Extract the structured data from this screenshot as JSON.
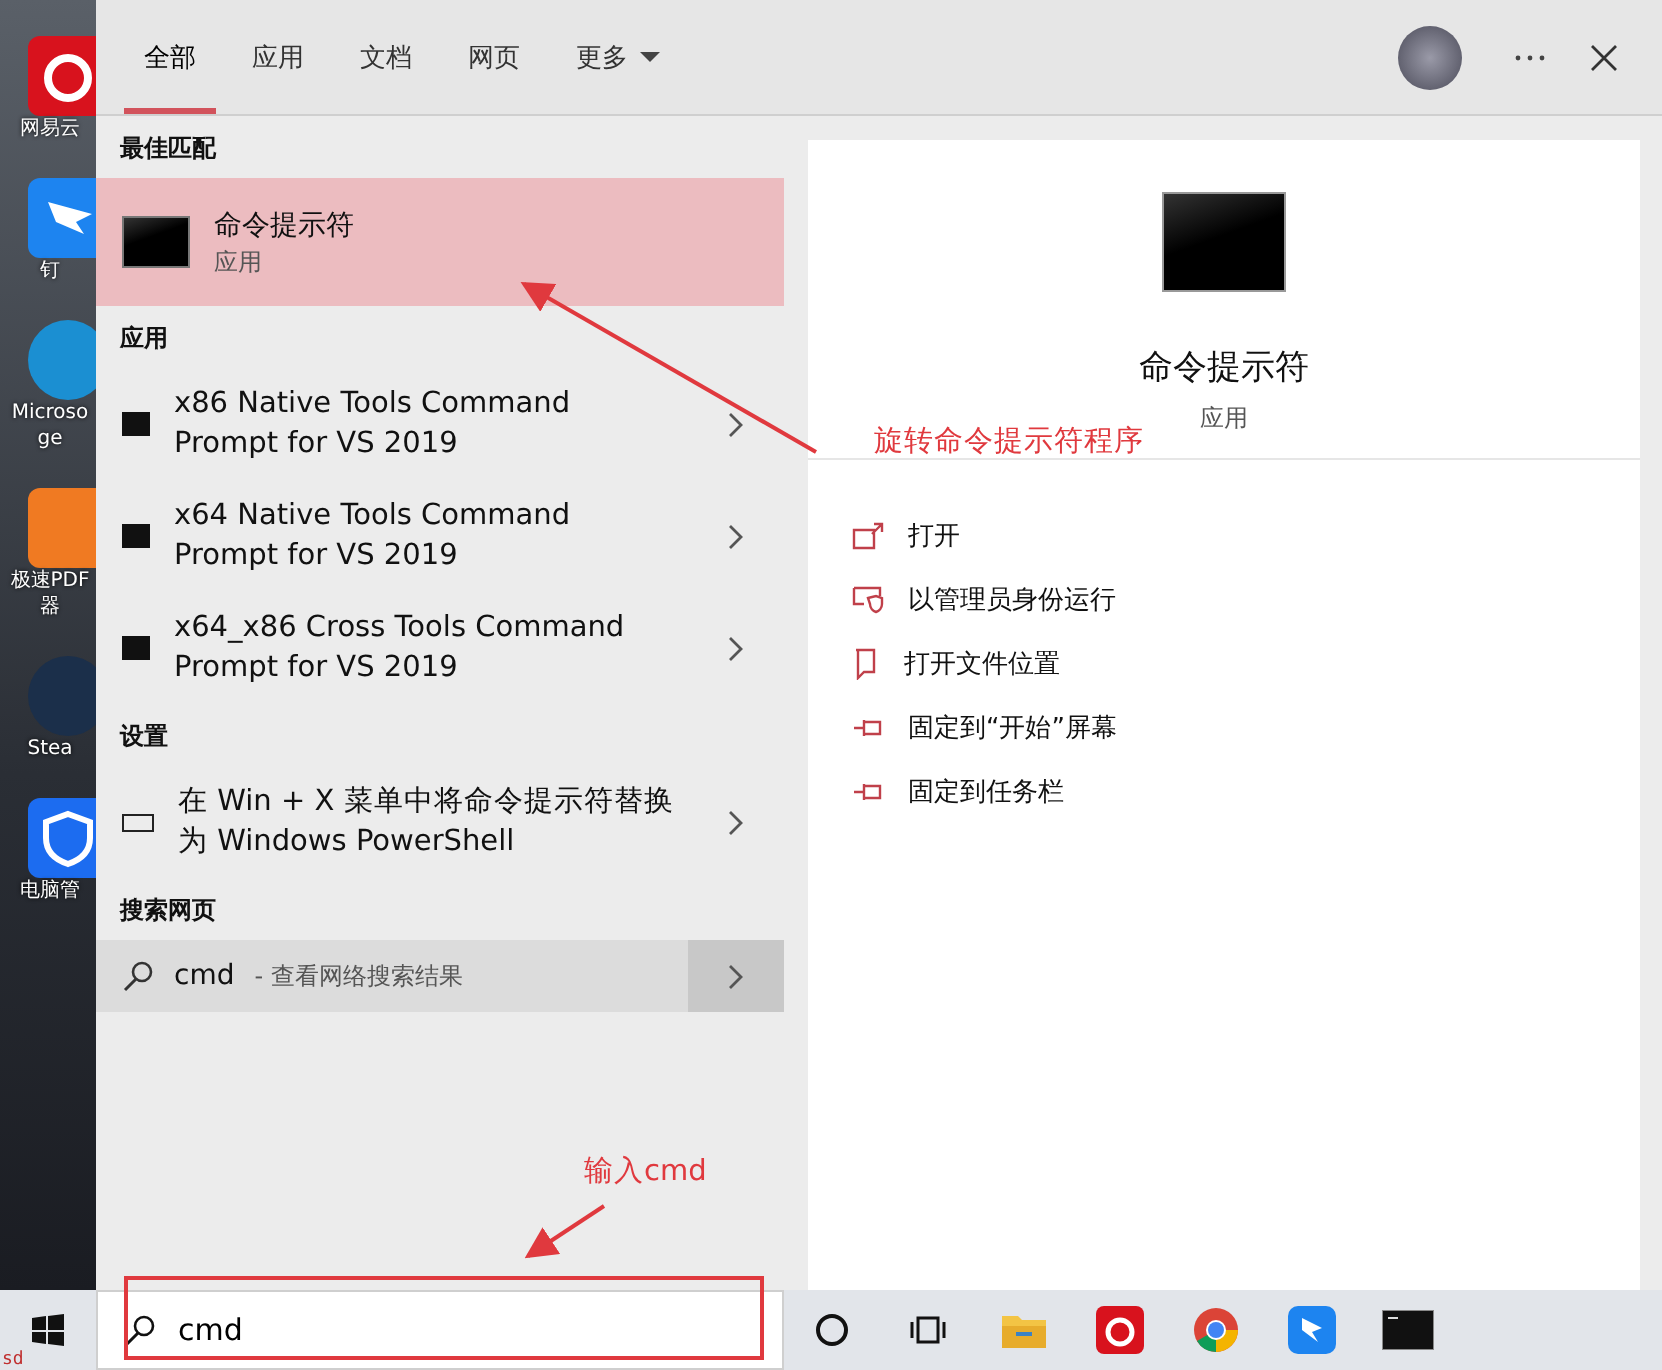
{
  "desktop_icons": [
    {
      "label_lines": [
        "网易云"
      ],
      "kind": "netease"
    },
    {
      "label_lines": [
        "钉"
      ],
      "kind": "dingtalk"
    },
    {
      "label_lines": [
        "Microso",
        "ge"
      ],
      "kind": "edge"
    },
    {
      "label_lines": [
        "极速PDF",
        "器"
      ],
      "kind": "pdf"
    },
    {
      "label_lines": [
        "Stea"
      ],
      "kind": "steam"
    },
    {
      "label_lines": [
        "电脑管"
      ],
      "kind": "shield"
    }
  ],
  "corner_text": "sd",
  "tabs": [
    {
      "label": "全部",
      "selected": true
    },
    {
      "label": "应用",
      "selected": false
    },
    {
      "label": "文档",
      "selected": false
    },
    {
      "label": "网页",
      "selected": false
    }
  ],
  "more_menu": {
    "label": "更多"
  },
  "best_match": {
    "heading": "最佳匹配",
    "title": "命令提示符",
    "subtitle": "应用",
    "selected": true
  },
  "sections": [
    {
      "heading": "应用",
      "items": [
        {
          "title": "x86 Native Tools Command Prompt for VS 2019",
          "kind": "app"
        },
        {
          "title": "x64 Native Tools Command Prompt for VS 2019",
          "kind": "app"
        },
        {
          "title": "x64_x86 Cross Tools Command Prompt for VS 2019",
          "kind": "app"
        }
      ]
    },
    {
      "heading": "设置",
      "items": [
        {
          "title": "在 Win + X 菜单中将命令提示符替换为 Windows PowerShell",
          "kind": "setting"
        }
      ]
    }
  ],
  "web_search": {
    "heading": "搜索网页",
    "query": "cmd",
    "suffix": "- 查看网络搜索结果"
  },
  "preview": {
    "title": "命令提示符",
    "subtitle": "应用",
    "actions": [
      {
        "label": "打开",
        "kind": "open"
      },
      {
        "label": "以管理员身份运行",
        "kind": "admin"
      },
      {
        "label": "打开文件位置",
        "kind": "folder"
      },
      {
        "label": "固定到“开始”屏幕",
        "kind": "pin"
      },
      {
        "label": "固定到任务栏",
        "kind": "pin"
      }
    ]
  },
  "taskbar": {
    "search_value": "cmd",
    "apps": [
      {
        "kind": "cortana"
      },
      {
        "kind": "taskview"
      },
      {
        "kind": "folder"
      },
      {
        "kind": "netease"
      },
      {
        "kind": "chrome"
      },
      {
        "kind": "dingtalk"
      },
      {
        "kind": "terminal"
      }
    ]
  },
  "annotations": [
    {
      "text": "旋转命令提示符程序",
      "kind": "callout"
    },
    {
      "text": "输入cmd",
      "kind": "input"
    }
  ]
}
